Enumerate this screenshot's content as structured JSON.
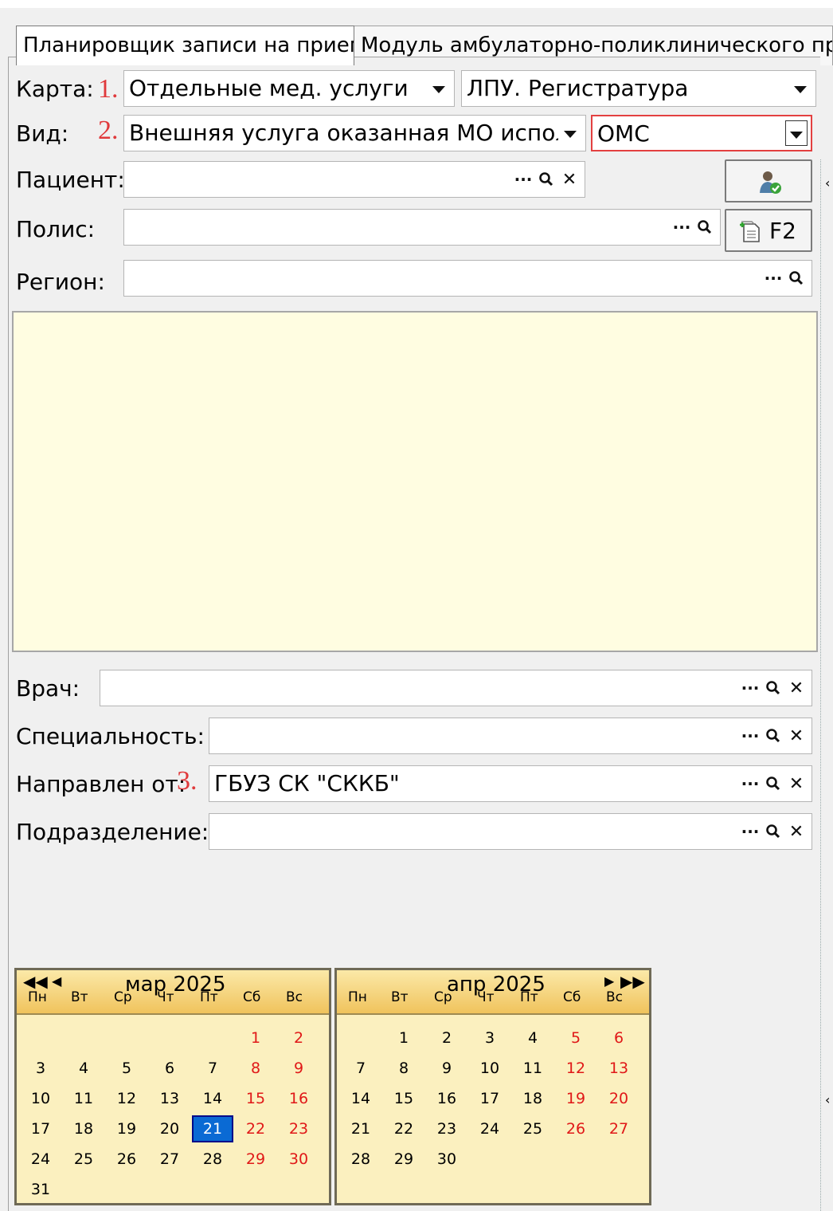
{
  "tabs": [
    {
      "label": "Планировщик записи на прием"
    },
    {
      "label": "Модуль амбулаторно-поликлинического при"
    }
  ],
  "form": {
    "karta": {
      "label": "Карта:",
      "marker": "1.",
      "value": "Отдельные мед. услуги",
      "value2": "ЛПУ. Регистратура"
    },
    "vid": {
      "label": "Вид:",
      "marker": "2.",
      "value": "Внешняя услуга оказанная МО исполн",
      "value2": "ОМС"
    },
    "patient": {
      "label": "Пациент:",
      "value": ""
    },
    "polis": {
      "label": "Полис:",
      "value": "",
      "button": "F2"
    },
    "region": {
      "label": "Регион:",
      "value": ""
    },
    "vrach": {
      "label": "Врач:",
      "value": ""
    },
    "spec": {
      "label": "Специальность:",
      "value": ""
    },
    "napravlen": {
      "label": "Направлен от:",
      "marker": "3.",
      "value": "ГБУЗ СК \"СККБ\""
    },
    "podrazd": {
      "label": "Подразделение:",
      "value": ""
    }
  },
  "icons": {
    "ellipsis": "···",
    "search": "magnifier-icon",
    "clear": "✕",
    "patient_button": "user-add-icon",
    "polis_button": "new-document-icon"
  },
  "colors": {
    "accent_red": "#e0393b",
    "selected_day": "#0a6ad4",
    "memo_bg": "#fffde1",
    "calendar_bg": "#fbf0bf"
  },
  "calendar": {
    "weekdays": [
      "Пн",
      "Вт",
      "Ср",
      "Чт",
      "Пт",
      "Сб",
      "Вс"
    ],
    "months": [
      {
        "title": "мар 2025",
        "first_weekday": 6,
        "days": 31,
        "selected": 21
      },
      {
        "title": "апр 2025",
        "first_weekday": 2,
        "days": 30,
        "selected": null
      }
    ]
  }
}
